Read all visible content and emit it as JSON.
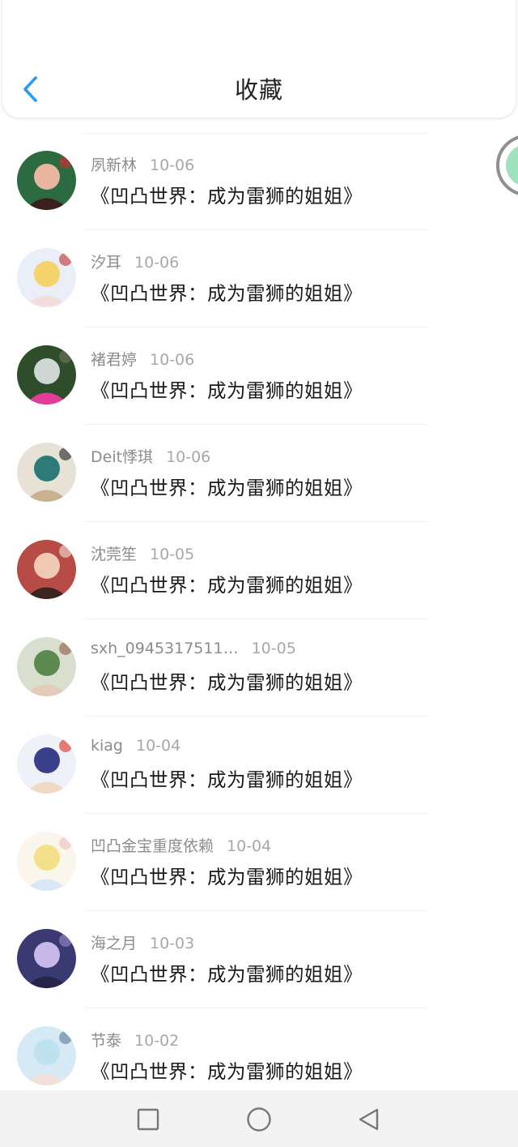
{
  "header": {
    "title": "收藏",
    "back_icon": "chevron-left-icon"
  },
  "colors": {
    "accent": "#2f9bea",
    "floating_button": "#9fe2c0"
  },
  "favorites": [
    {
      "user": "夙新林",
      "date": "10-06",
      "work": "《凹凸世界：成为雷狮的姐姐》"
    },
    {
      "user": "汐耳",
      "date": "10-06",
      "work": "《凹凸世界：成为雷狮的姐姐》"
    },
    {
      "user": "褚君婷",
      "date": "10-06",
      "work": "《凹凸世界：成为雷狮的姐姐》"
    },
    {
      "user": "Deit悸琪",
      "date": "10-06",
      "work": "《凹凸世界：成为雷狮的姐姐》"
    },
    {
      "user": "沈莞笙",
      "date": "10-05",
      "work": "《凹凸世界：成为雷狮的姐姐》"
    },
    {
      "user": "sxh_0945317511…",
      "date": "10-05",
      "work": "《凹凸世界：成为雷狮的姐姐》"
    },
    {
      "user": "kiag",
      "date": "10-04",
      "work": "《凹凸世界：成为雷狮的姐姐》"
    },
    {
      "user": "凹凸金宝重度依赖",
      "date": "10-04",
      "work": "《凹凸世界：成为雷狮的姐姐》"
    },
    {
      "user": "海之月",
      "date": "10-03",
      "work": "《凹凸世界：成为雷狮的姐姐》"
    },
    {
      "user": "节泰",
      "date": "10-02",
      "work": "《凹凸世界：成为雷狮的姐姐》"
    }
  ],
  "navbar": {
    "icons": [
      "recent-apps-icon",
      "home-icon",
      "back-icon"
    ]
  }
}
